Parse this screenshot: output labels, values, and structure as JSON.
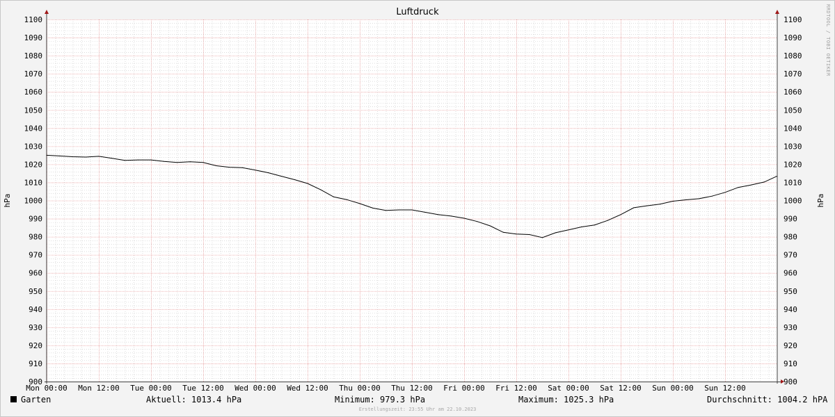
{
  "chart_data": {
    "type": "line",
    "title": "Luftdruck",
    "ylabel_left": "hPa",
    "ylabel_right": "hPa",
    "ylim": [
      900,
      1100
    ],
    "y_ticks": [
      900,
      910,
      920,
      930,
      940,
      950,
      960,
      970,
      980,
      990,
      1000,
      1010,
      1020,
      1030,
      1040,
      1050,
      1060,
      1070,
      1080,
      1090,
      1100
    ],
    "x_ticks": [
      "Mon 00:00",
      "Mon 12:00",
      "Tue 00:00",
      "Tue 12:00",
      "Wed 00:00",
      "Wed 12:00",
      "Thu 00:00",
      "Thu 12:00",
      "Fri 00:00",
      "Fri 12:00",
      "Sat 00:00",
      "Sat 12:00",
      "Sun 00:00",
      "Sun 12:00"
    ],
    "grid": true,
    "legend_position": "bottom-left",
    "series": [
      {
        "name": "Garten",
        "color": "#000000",
        "x_hours": [
          0,
          3,
          6,
          9,
          12,
          15,
          18,
          21,
          24,
          27,
          30,
          33,
          36,
          39,
          42,
          45,
          48,
          51,
          54,
          57,
          60,
          63,
          66,
          69,
          72,
          75,
          78,
          81,
          84,
          87,
          90,
          93,
          96,
          99,
          102,
          105,
          108,
          111,
          114,
          117,
          120,
          123,
          126,
          129,
          132,
          135,
          138,
          141,
          144,
          147,
          150,
          153,
          156,
          159,
          162,
          165,
          167.9
        ],
        "values": [
          1025,
          1024.6,
          1024.2,
          1024,
          1024.4,
          1023.3,
          1022.2,
          1022.4,
          1022.4,
          1021.6,
          1021,
          1021.4,
          1021,
          1019.2,
          1018.4,
          1018.1,
          1016.8,
          1015.3,
          1013.4,
          1011.5,
          1009.4,
          1006,
          1002,
          1000.5,
          998.3,
          995.8,
          994.5,
          994.8,
          994.8,
          993.5,
          992.2,
          991.4,
          990.2,
          988.4,
          986,
          982.4,
          981.5,
          981.2,
          979.5,
          982.2,
          983.8,
          985.4,
          986.5,
          989,
          992.2,
          996,
          997.1,
          998,
          999.6,
          1000.4,
          1001,
          1002.4,
          1004.5,
          1007.2,
          1008.6,
          1010.2,
          1013.4
        ]
      }
    ]
  },
  "watermark": "RRDTOOL / TOBI OETIKER",
  "legend": {
    "series_label": "Garten",
    "current": "Aktuell: 1013.4 hPa",
    "minimum": "Minimum: 979.3 hPa",
    "maximum": "Maximum: 1025.3 hPa",
    "average": "Durchschnitt: 1004.2 hPA"
  },
  "footer": "Erstellungszeit: 23:55 Uhr am 22.10.2023",
  "colors": {
    "background": "#f3f3f3",
    "plot": "#ffffff",
    "major_grid": "#e8a0a0",
    "minor_grid": "#c8c8c8",
    "axis_arrow": "#a01818",
    "line": "#000000"
  }
}
